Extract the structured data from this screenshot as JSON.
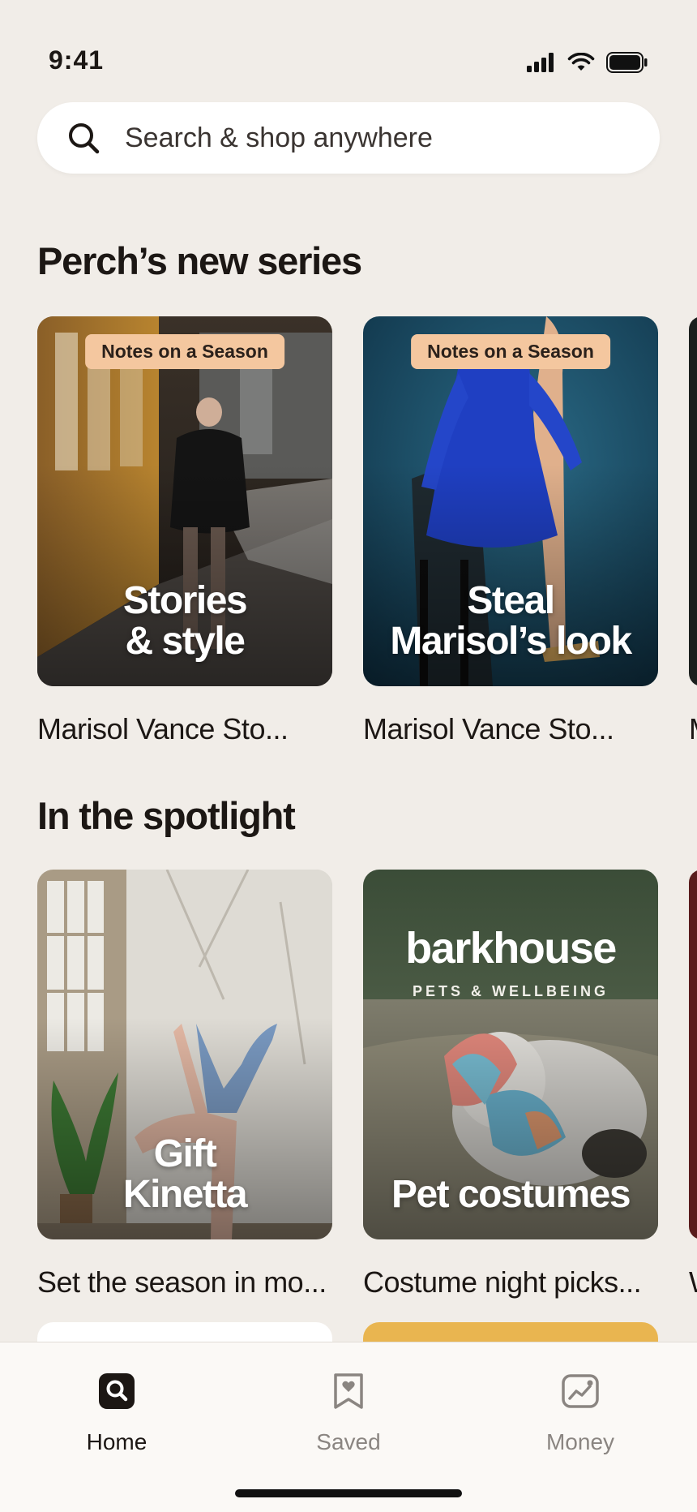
{
  "status_bar": {
    "time": "9:41"
  },
  "search": {
    "placeholder": "Search & shop anywhere"
  },
  "series": {
    "title": "Perch’s new series",
    "cards": [
      {
        "badge": "Notes on a Season",
        "title_line1": "Stories",
        "title_line2": "& style",
        "caption": "Marisol Vance Sto..."
      },
      {
        "badge": "Notes on a Season",
        "title_line1": "Steal",
        "title_line2": "Marisol’s look",
        "caption": "Marisol Vance Sto..."
      }
    ]
  },
  "spotlight": {
    "title": "In the spotlight",
    "cards": [
      {
        "title_line1": "Gift",
        "title_line2": "Kinetta",
        "caption": "Set the season in mo..."
      },
      {
        "brand": "barkhouse",
        "brand_sub": "PETS & WELLBEING",
        "title_line1": "Pet costumes",
        "caption": "Costume night picks..."
      }
    ]
  },
  "tabbar": {
    "items": [
      {
        "label": "Home",
        "icon": "search-bag-icon",
        "active": true
      },
      {
        "label": "Saved",
        "icon": "bookmark-heart-icon",
        "active": false
      },
      {
        "label": "Money",
        "icon": "chart-trend-icon",
        "active": false
      }
    ]
  },
  "colors": {
    "background": "#f1ede8",
    "badge": "#f4c79f",
    "accent_yellow": "#e9b550"
  }
}
